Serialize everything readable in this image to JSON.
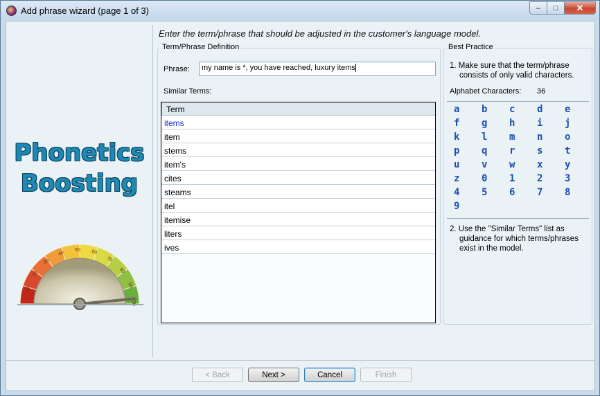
{
  "window": {
    "title": "Add phrase wizard (page 1 of 3)",
    "controls": {
      "minimize": "–",
      "maximize": "□",
      "close": "✕"
    }
  },
  "brand": {
    "title_line1": "Phonetics",
    "title_line2": "Boosting",
    "gauge": {
      "ticks": [
        "10",
        "20",
        "30",
        "40",
        "50",
        "60",
        "70",
        "80",
        "90",
        "100"
      ],
      "needle_value": 97
    }
  },
  "instruction": "Enter the term/phrase that should be adjusted in the customer's language model.",
  "term_group": {
    "label": "Term/Phrase Definition",
    "phrase_label": "Phrase:",
    "phrase_value": "my name is *, you have reached, luxury items",
    "similar_label": "Similar Terms:",
    "grid": {
      "column": "Term",
      "rows": [
        "items",
        "item",
        "stems",
        "item's",
        "cites",
        "steams",
        "itel",
        "itemise",
        "liters",
        "ives"
      ],
      "selected_index": 0
    }
  },
  "best_practice": {
    "label": "Best Practice",
    "tip1_line1": "1. Make sure that the term/phrase",
    "tip1_line2": "consists of only valid characters.",
    "alphabet_label": "Alphabet Characters:",
    "alphabet_count": "36",
    "characters": [
      "a",
      "b",
      "c",
      "d",
      "e",
      "f",
      "g",
      "h",
      "i",
      "j",
      "k",
      "l",
      "m",
      "n",
      "o",
      "p",
      "q",
      "r",
      "s",
      "t",
      "u",
      "v",
      "w",
      "x",
      "y",
      "z",
      "0",
      "1",
      "2",
      "3",
      "4",
      "5",
      "6",
      "7",
      "8",
      "9"
    ],
    "tip2_line1": "2. Use the \"Similar Terms\" list as",
    "tip2_line2": "guidance for which terms/phrases",
    "tip2_line3": "exist in the model."
  },
  "buttons": {
    "back": "< Back",
    "next": "Next >",
    "cancel": "Cancel",
    "finish": "Finish"
  },
  "colors": {
    "brand_text": "#1f89b3",
    "char_text": "#1e4fae",
    "selected_row": "#1b2fd0"
  }
}
